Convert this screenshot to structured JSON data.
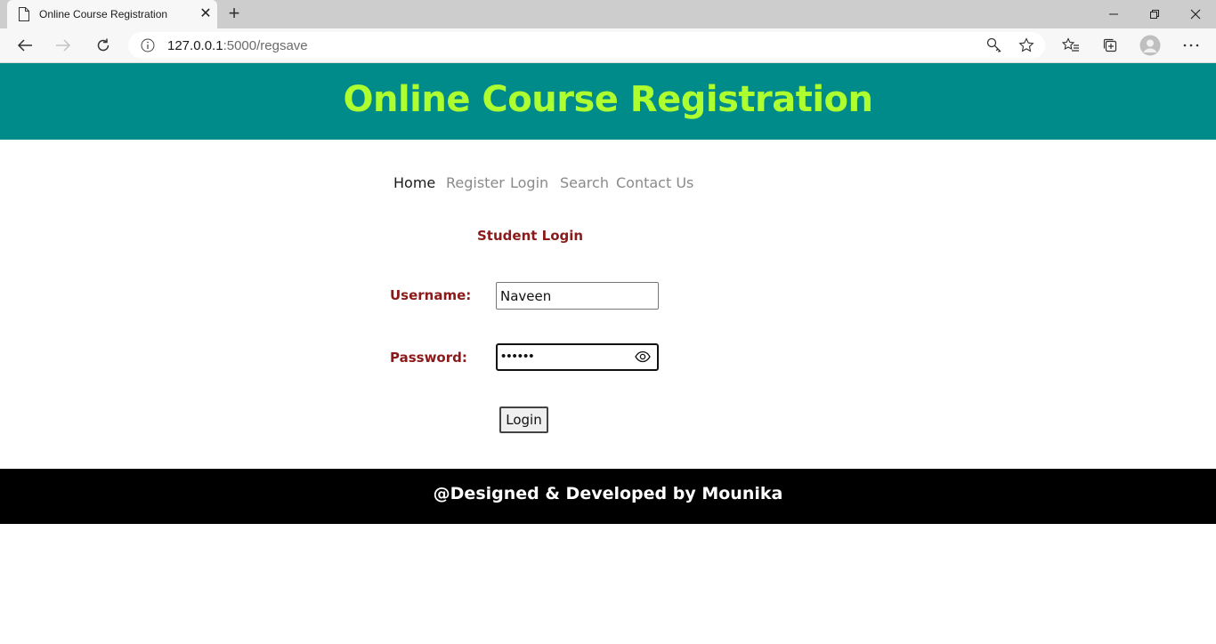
{
  "browser": {
    "tab_title": "Online Course Registration",
    "tab_close": "✕",
    "new_tab": "+",
    "url_host": "127.0.0.1",
    "url_path": ":5000/regsave"
  },
  "header": {
    "title": "Online Course Registration",
    "bg_color": "#008b8b",
    "title_color": "#adff2f"
  },
  "nav": {
    "items": [
      {
        "label": "Home"
      },
      {
        "label": "Register"
      },
      {
        "label": "Login"
      },
      {
        "label": "Search"
      },
      {
        "label": "Contact Us"
      }
    ]
  },
  "login_form": {
    "title": "Student Login",
    "username_label": "Username:",
    "username_value": "Naveen",
    "password_label": "Password:",
    "password_mask": "••••••",
    "submit_label": "Login",
    "label_color": "#8b1a1a"
  },
  "footer": {
    "text": "@Designed & Developed by Mounika"
  },
  "icons": [
    "page-icon",
    "close-icon",
    "plus-icon",
    "minimize-icon",
    "restore-icon",
    "window-close-icon",
    "back-icon",
    "forward-icon",
    "refresh-icon",
    "info-icon",
    "key-icon",
    "star-icon",
    "favorites-icon",
    "collections-icon",
    "profile-icon",
    "more-icon",
    "eye-icon"
  ]
}
